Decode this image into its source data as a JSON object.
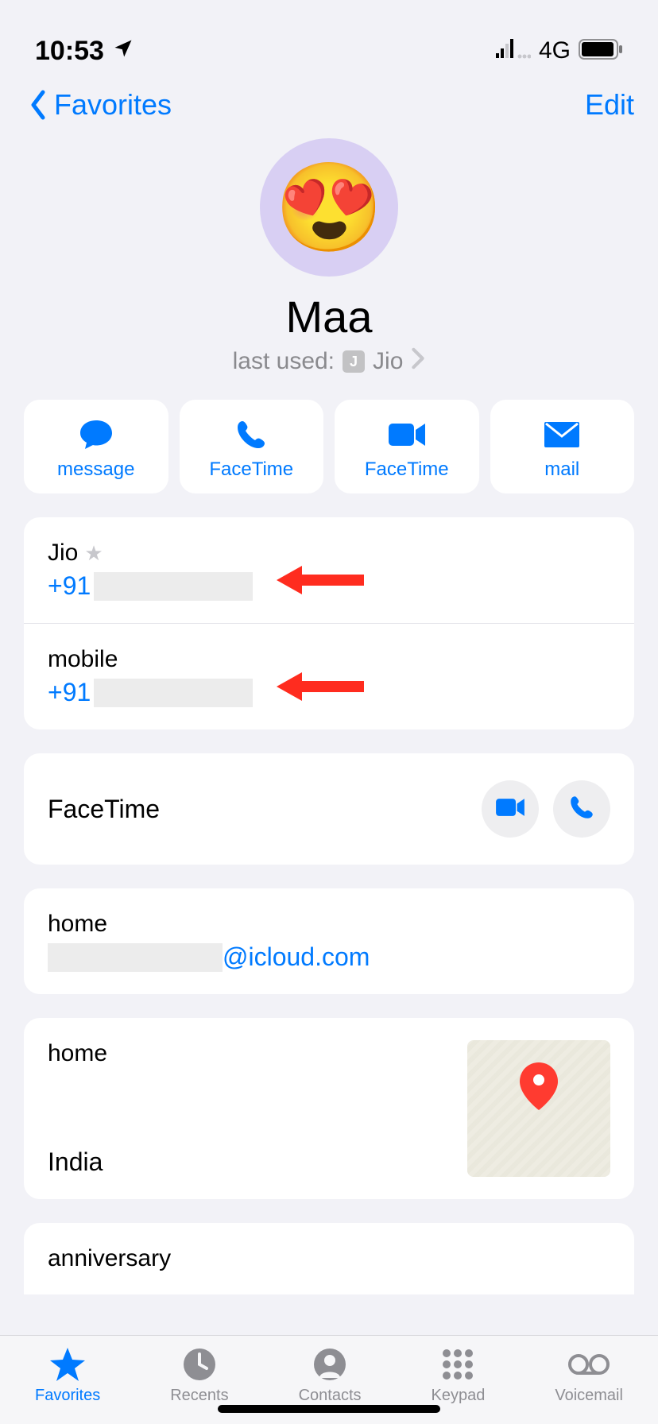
{
  "status": {
    "time": "10:53",
    "network": "4G"
  },
  "nav": {
    "back_label": "Favorites",
    "edit_label": "Edit"
  },
  "contact": {
    "avatar_emoji": "😍",
    "name": "Maa",
    "last_used_prefix": "last used:",
    "last_used_sim_badge": "J",
    "last_used_sim": "Jio"
  },
  "actions": [
    {
      "id": "message",
      "label": "message"
    },
    {
      "id": "facetime-audio",
      "label": "FaceTime"
    },
    {
      "id": "facetime-video",
      "label": "FaceTime"
    },
    {
      "id": "mail",
      "label": "mail"
    }
  ],
  "phones": [
    {
      "label": "Jio",
      "starred": true,
      "prefix": "+91",
      "number_redacted": true
    },
    {
      "label": "mobile",
      "starred": false,
      "prefix": "+91",
      "number_redacted": true
    }
  ],
  "facetime": {
    "label": "FaceTime"
  },
  "email": {
    "label": "home",
    "domain": "@icloud.com",
    "local_redacted": true
  },
  "address": {
    "label": "home",
    "country": "India"
  },
  "dates": {
    "label": "anniversary"
  },
  "tabs": [
    {
      "id": "favorites",
      "label": "Favorites",
      "active": true
    },
    {
      "id": "recents",
      "label": "Recents",
      "active": false
    },
    {
      "id": "contacts",
      "label": "Contacts",
      "active": false
    },
    {
      "id": "keypad",
      "label": "Keypad",
      "active": false
    },
    {
      "id": "voicemail",
      "label": "Voicemail",
      "active": false
    }
  ]
}
